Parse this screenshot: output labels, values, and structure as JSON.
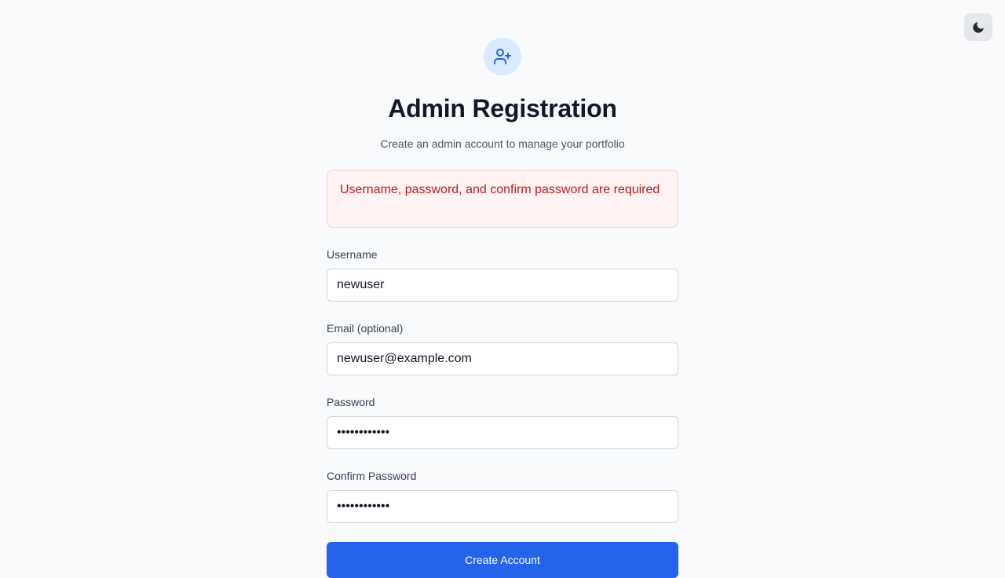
{
  "theme_toggle": {
    "icon": "moon-icon"
  },
  "header": {
    "icon": "user-plus-icon",
    "title": "Admin Registration",
    "subtitle": "Create an admin account to manage your portfolio"
  },
  "error": {
    "message": "Username, password, and confirm password are required"
  },
  "form": {
    "username": {
      "label": "Username",
      "value": "newuser"
    },
    "email": {
      "label": "Email (optional)",
      "value": "newuser@example.com"
    },
    "password": {
      "label": "Password",
      "value": "••••••••••••"
    },
    "confirm_password": {
      "label": "Confirm Password",
      "value": "••••••••••••"
    },
    "submit_label": "Create Account"
  },
  "colors": {
    "primary": "#2563eb",
    "error_text": "#b91c1c",
    "error_bg": "#fef2f2",
    "page_bg": "#f8fafc"
  }
}
